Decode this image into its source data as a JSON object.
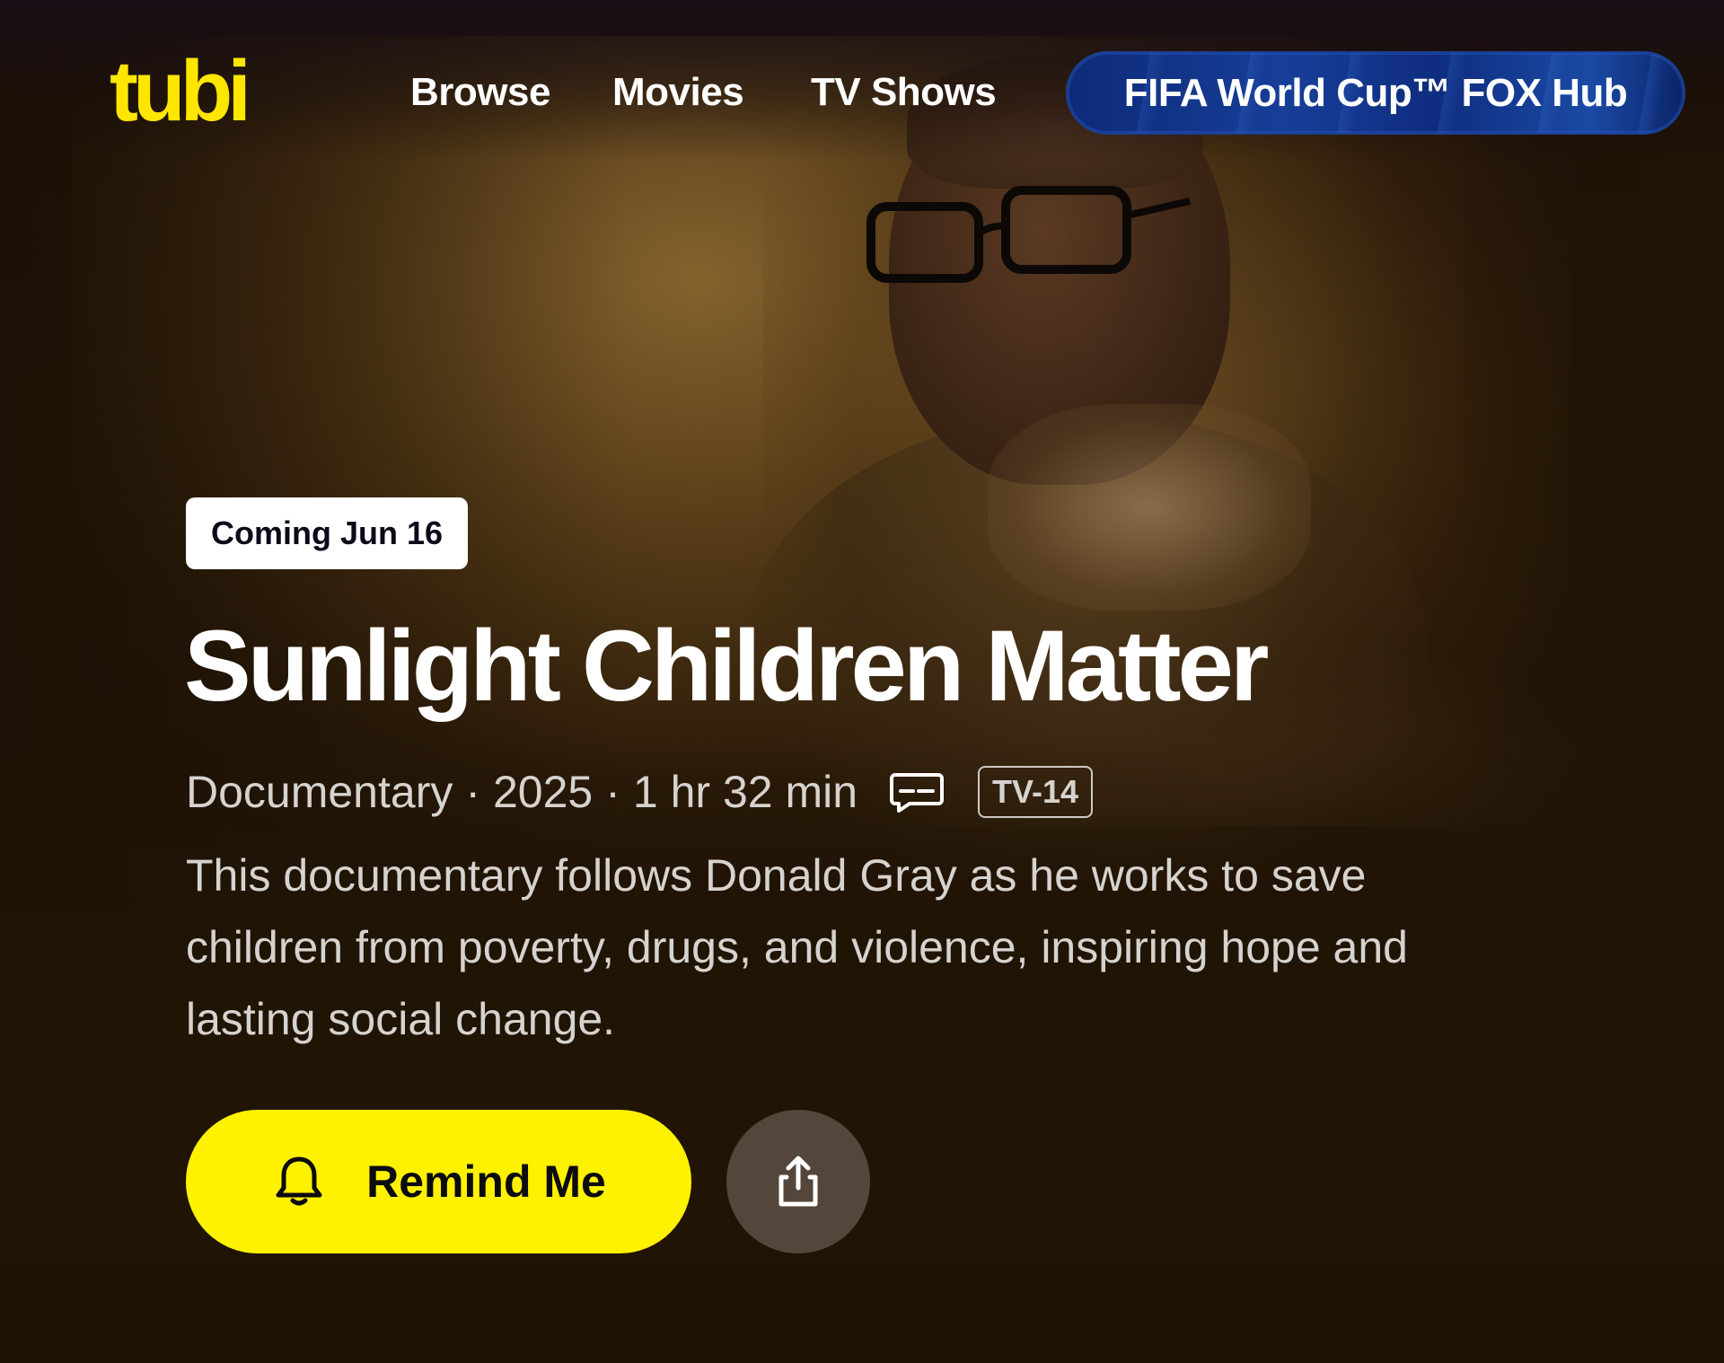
{
  "header": {
    "logo_text": "tubi",
    "nav": {
      "browse": "Browse",
      "movies": "Movies",
      "tv_shows": "TV Shows"
    },
    "promo_button": "FIFA World Cup™ FOX Hub"
  },
  "hero": {
    "badge": "Coming Jun 16",
    "title": "Sunlight Children Matter",
    "genre": "Documentary",
    "separator": "·",
    "year": "2025",
    "duration": "1 hr 32 min",
    "captions_icon": "closed-captions-icon",
    "rating": "TV-14",
    "description": "This documentary follows Donald Gray as he works to save children from poverty, drugs, and violence, inspiring hope and lasting social change.",
    "remind_button": "Remind Me",
    "remind_icon": "bell-icon",
    "share_icon": "share-icon"
  },
  "colors": {
    "brand_yellow": "#fff200",
    "background": "#211405",
    "promo_blue": "#173e98",
    "share_button": "#54463a"
  }
}
